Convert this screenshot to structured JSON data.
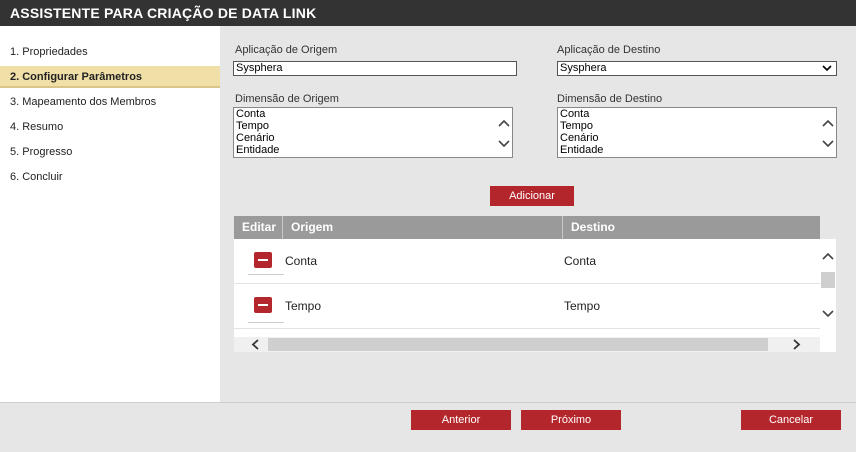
{
  "window": {
    "title": "ASSISTENTE PARA CRIAÇÃO DE DATA LINK"
  },
  "steps": [
    {
      "label": "1. Propriedades"
    },
    {
      "label": "2. Configurar Parâmetros"
    },
    {
      "label": "3. Mapeamento dos Membros"
    },
    {
      "label": "4. Resumo"
    },
    {
      "label": "5. Progresso"
    },
    {
      "label": "6. Concluir"
    }
  ],
  "active_step_index": 1,
  "form": {
    "source_app_label": "Aplicação de Origem",
    "source_app_value": "Sysphera",
    "target_app_label": "Aplicação de Destino",
    "target_app_value": "Sysphera",
    "source_dim_label": "Dimensão de Origem",
    "source_dims": [
      "Conta",
      "Tempo",
      "Cenário",
      "Entidade"
    ],
    "target_dim_label": "Dimensão de Destino",
    "target_dims": [
      "Conta",
      "Tempo",
      "Cenário",
      "Entidade"
    ],
    "add_label": "Adicionar"
  },
  "grid": {
    "headers": {
      "edit": "Editar",
      "source": "Origem",
      "target": "Destino"
    },
    "rows": [
      {
        "source": "Conta",
        "target": "Conta"
      },
      {
        "source": "Tempo",
        "target": "Tempo"
      }
    ]
  },
  "footer": {
    "back_label": "Anterior",
    "next_label": "Próximo",
    "cancel_label": "Cancelar"
  },
  "colors": {
    "titlebar": "#333333",
    "accent_red": "#b3262c",
    "active_step": "#f1dfa8",
    "grid_header": "#9a9a9a"
  }
}
